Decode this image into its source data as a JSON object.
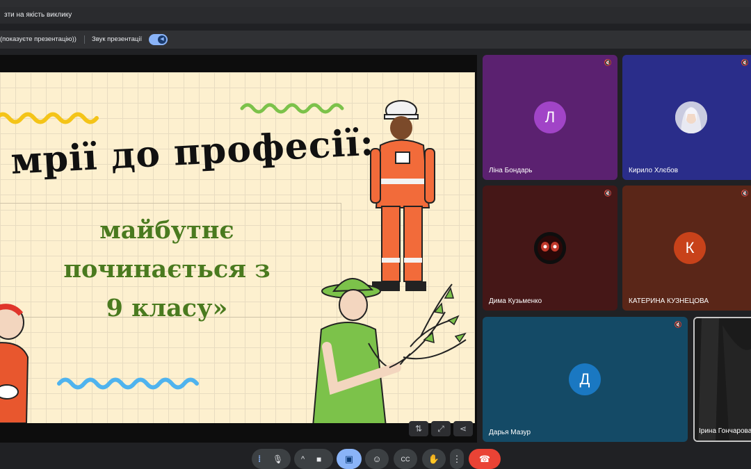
{
  "notice": {
    "text": "зти на якість виклику"
  },
  "presenting": {
    "status_text": "(показуєте презентацію))",
    "sound_label": "Звук презентації",
    "sound_on": true
  },
  "slide": {
    "title": "мрії до професії:",
    "subtitle_lines": [
      "майбутнє",
      "починається з",
      "9 класу»"
    ]
  },
  "slide_tools": [
    {
      "icon": "swap-vertical-icon",
      "glyph": "⇅"
    },
    {
      "icon": "fullscreen-icon",
      "glyph": "⤢"
    },
    {
      "icon": "share-icon",
      "glyph": "⋖"
    }
  ],
  "participants": [
    {
      "name": "Ліна Бондарь",
      "initial": "Л",
      "muted": true,
      "bg": "#5b2170",
      "avatar_color": "#a144c7"
    },
    {
      "name": "Кирило Хлєбов",
      "initial": "",
      "muted": true,
      "bg": "#2a2d8a",
      "avatar_color": "#e6e6f0"
    },
    {
      "name": "Дима Кузьменко",
      "initial": "",
      "muted": true,
      "bg": "#451717",
      "avatar_color": "#1a1a1a"
    },
    {
      "name": "КАТЕРИНА КУЗНЕЦОВА",
      "initial": "К",
      "muted": true,
      "bg": "#5a2618",
      "avatar_color": "#c8421a"
    },
    {
      "name": "Дарья Мазур",
      "initial": "Д",
      "muted": true,
      "bg": "#144a66",
      "avatar_color": "#1a78c2"
    },
    {
      "name": "Ірина Гончарова",
      "initial": "",
      "muted": false,
      "bg": "#1d1d1d",
      "avatar_color": "#333"
    }
  ],
  "controls": [
    {
      "name": "audio-level-icon",
      "glyph": "⁞"
    },
    {
      "name": "mic-icon",
      "glyph": "🎙"
    },
    {
      "name": "chevron-up-icon",
      "glyph": "^"
    },
    {
      "name": "camera-icon",
      "glyph": "■"
    },
    {
      "name": "present-screen-icon",
      "glyph": "▣"
    },
    {
      "name": "emoji-icon",
      "glyph": "☺"
    },
    {
      "name": "captions-icon",
      "glyph": "CC"
    },
    {
      "name": "raise-hand-icon",
      "glyph": "✋"
    },
    {
      "name": "more-options-icon",
      "glyph": "⋮"
    },
    {
      "name": "leave-call-icon",
      "glyph": "☎"
    }
  ],
  "colors": {
    "accent": "#8ab4f8",
    "leave": "#ea4335",
    "slide_bg": "#fdf0cf",
    "slide_green": "#4a7a1f"
  }
}
